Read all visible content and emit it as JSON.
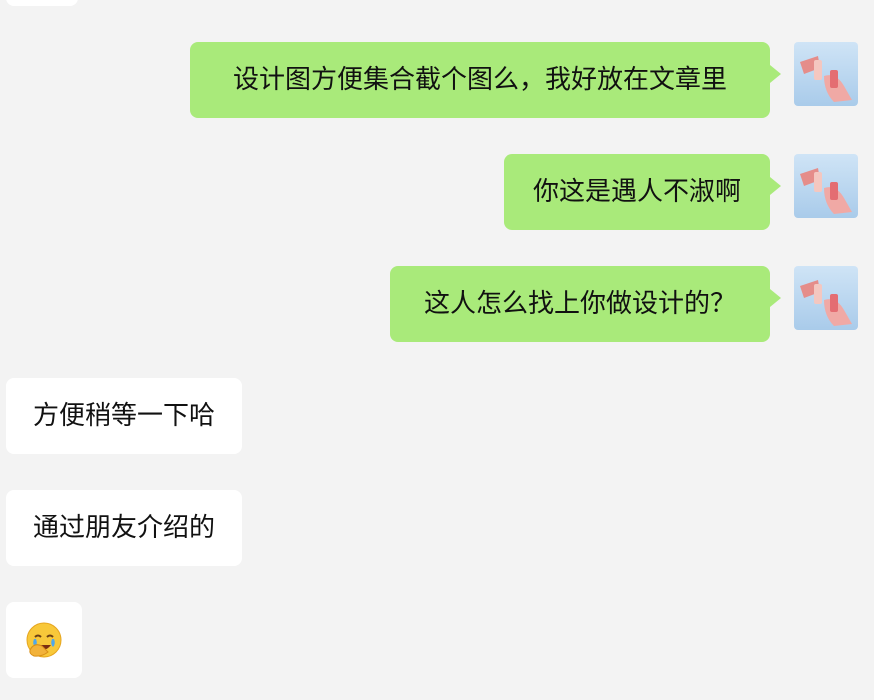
{
  "chat": {
    "messages": [
      {
        "direction": "outgoing",
        "text": "设计图方便集合截个图么，我好放在文章里"
      },
      {
        "direction": "outgoing",
        "text": "你这是遇人不淑啊"
      },
      {
        "direction": "outgoing",
        "text": "这人怎么找上你做设计的？"
      },
      {
        "direction": "incoming",
        "text": "方便稍等一下哈"
      },
      {
        "direction": "incoming",
        "text": "通过朋友介绍的"
      },
      {
        "direction": "incoming",
        "emoji": "face-palm-crying-emoji"
      }
    ]
  },
  "colors": {
    "background": "#f3f3f3",
    "outgoing_bubble": "#a9ea7a",
    "incoming_bubble": "#ffffff",
    "avatar_sky": "#b9d7f0"
  }
}
